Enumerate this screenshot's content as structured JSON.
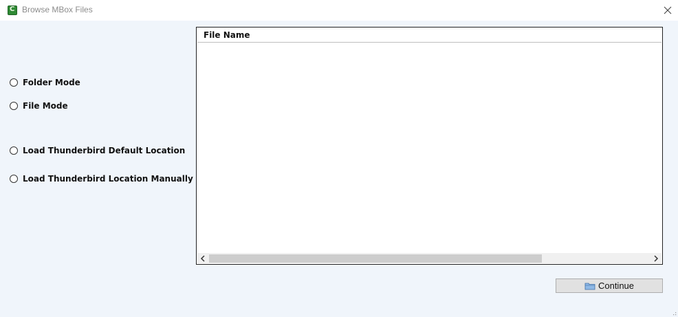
{
  "window": {
    "title": "Browse MBox Files",
    "icon": "app-c-icon",
    "icon_color": "#2f8a34"
  },
  "modes": [
    {
      "label": "Folder Mode",
      "selected": false
    },
    {
      "label": "File Mode",
      "selected": false
    },
    {
      "label": "Load Thunderbird Default Location",
      "selected": false
    },
    {
      "label": "Load Thunderbird Location Manually",
      "selected": false
    }
  ],
  "file_list": {
    "column_header": "File Name",
    "rows": []
  },
  "actions": {
    "continue_label": "Continue",
    "continue_icon": "folder-icon"
  },
  "colors": {
    "background": "#f0f5fb",
    "panel": "#ffffff",
    "button": "#e1e1e1"
  }
}
